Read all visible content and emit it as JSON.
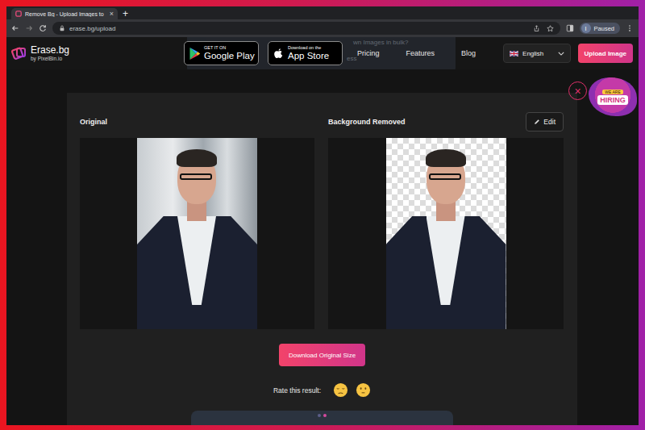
{
  "browser": {
    "tab_title": "Remove Bg - Upload Images to",
    "tab_close": "×",
    "new_tab": "+",
    "url": "erase.bg/upload",
    "profile": {
      "initial": "I",
      "status": "Paused"
    }
  },
  "header": {
    "logo": {
      "name": "Erase.bg",
      "by": "by PixelBin.io"
    },
    "stores": [
      {
        "small": "GET IT ON",
        "big": "Google Play",
        "kind": "google"
      },
      {
        "small": "Download on the",
        "big": "App Store",
        "kind": "apple"
      }
    ],
    "banner": {
      "line1": "wn Images in bulk?",
      "line2": "ess"
    },
    "nav": [
      "Pricing",
      "Features",
      "Blog"
    ],
    "language": "English",
    "upload": "Upload Image"
  },
  "hiring": {
    "close": "×",
    "top": "WE ARE",
    "label": "HIRING"
  },
  "panels": [
    {
      "title": "Original",
      "kind": "original"
    },
    {
      "title": "Background Removed",
      "kind": "removed"
    }
  ],
  "edit": "Edit",
  "download": "Download Original Size",
  "rating": {
    "label": "Rate this result:"
  },
  "carousel": [
    {
      "selected": false
    },
    {
      "selected": true
    }
  ]
}
